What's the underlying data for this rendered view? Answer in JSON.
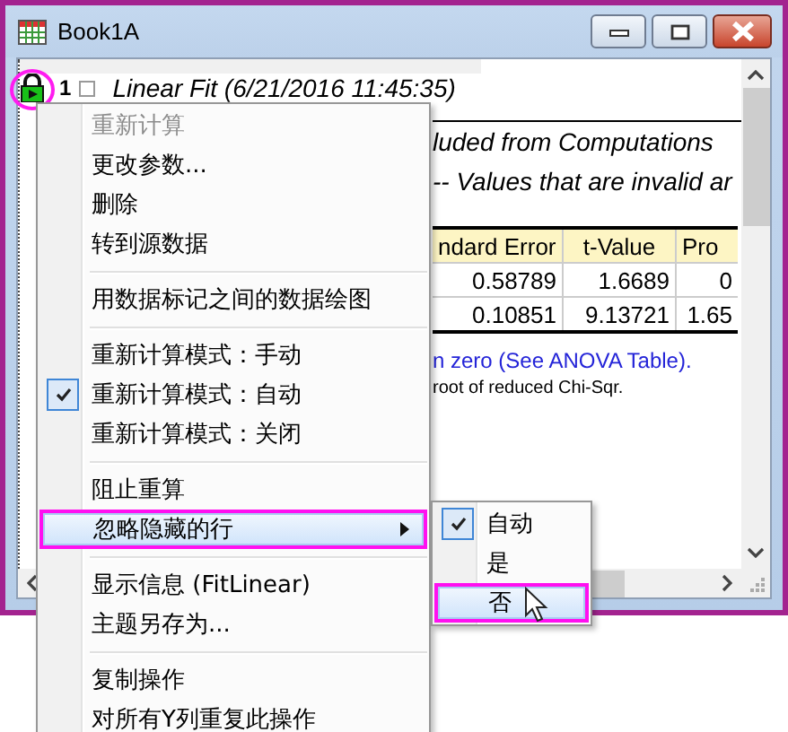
{
  "window": {
    "title": "Book1A"
  },
  "report": {
    "row_number": "1",
    "title": "Linear Fit (6/21/2016 11:45:35)",
    "lines": [
      "luded from Computations",
      "-- Values that are invalid ar"
    ],
    "table": {
      "columns": [
        "ndard Error",
        "t-Value",
        "Pro"
      ],
      "rows": [
        [
          "0.58789",
          "1.6689",
          "0"
        ],
        [
          "0.10851",
          "9.13721",
          "1.65"
        ]
      ]
    },
    "notes": [
      {
        "kind": "link",
        "text": "n zero (See ANOVA Table)."
      },
      {
        "kind": "plain",
        "text": "root of reduced Chi-Sqr."
      }
    ]
  },
  "context_menu": {
    "items": [
      {
        "kind": "item",
        "label": "重新计算",
        "disabled": true,
        "checked": false,
        "selected": false,
        "has_submenu": false
      },
      {
        "kind": "item",
        "label": "更改参数...",
        "disabled": false,
        "checked": false,
        "selected": false,
        "has_submenu": false
      },
      {
        "kind": "item",
        "label": "删除",
        "disabled": false,
        "checked": false,
        "selected": false,
        "has_submenu": false
      },
      {
        "kind": "item",
        "label": "转到源数据",
        "disabled": false,
        "checked": false,
        "selected": false,
        "has_submenu": false
      },
      {
        "kind": "separator"
      },
      {
        "kind": "item",
        "label": "用数据标记之间的数据绘图",
        "disabled": false,
        "checked": false,
        "selected": false,
        "has_submenu": false
      },
      {
        "kind": "separator"
      },
      {
        "kind": "item",
        "label": "重新计算模式：手动",
        "disabled": false,
        "checked": false,
        "selected": false,
        "has_submenu": false
      },
      {
        "kind": "item",
        "label": "重新计算模式：自动",
        "disabled": false,
        "checked": true,
        "selected": false,
        "has_submenu": false
      },
      {
        "kind": "item",
        "label": "重新计算模式：关闭",
        "disabled": false,
        "checked": false,
        "selected": false,
        "has_submenu": false
      },
      {
        "kind": "separator"
      },
      {
        "kind": "item",
        "label": "阻止重算",
        "disabled": false,
        "checked": false,
        "selected": false,
        "has_submenu": false
      },
      {
        "kind": "item",
        "label": "忽略隐藏的行",
        "disabled": false,
        "checked": false,
        "selected": true,
        "has_submenu": true
      },
      {
        "kind": "separator"
      },
      {
        "kind": "item",
        "label": "显示信息 (FitLinear)",
        "disabled": false,
        "checked": false,
        "selected": false,
        "has_submenu": false
      },
      {
        "kind": "item",
        "label": "主题另存为...",
        "disabled": false,
        "checked": false,
        "selected": false,
        "has_submenu": false
      },
      {
        "kind": "separator"
      },
      {
        "kind": "item",
        "label": "复制操作",
        "disabled": false,
        "checked": false,
        "selected": false,
        "has_submenu": false
      },
      {
        "kind": "item",
        "label": "对所有Y列重复此操作",
        "disabled": false,
        "checked": false,
        "selected": false,
        "has_submenu": false
      }
    ]
  },
  "submenu": {
    "items": [
      {
        "label": "自动",
        "checked": true,
        "selected": false
      },
      {
        "label": "是",
        "checked": false,
        "selected": false
      },
      {
        "label": "否",
        "checked": false,
        "selected": true
      }
    ]
  }
}
